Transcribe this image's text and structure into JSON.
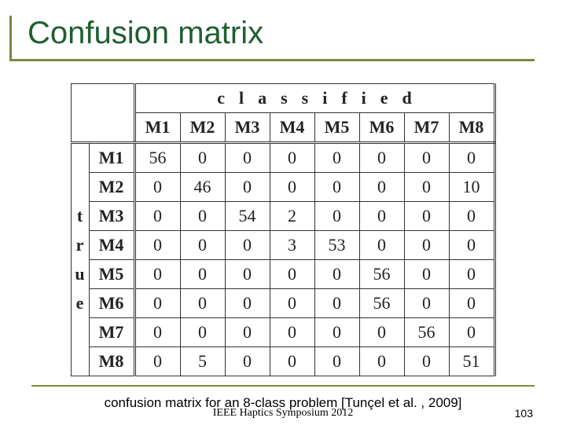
{
  "title": "Confusion matrix",
  "top_axis_label": "classified",
  "left_axis_label": [
    "t",
    "r",
    "u",
    "e"
  ],
  "col_headers": [
    "M1",
    "M2",
    "M3",
    "M4",
    "M5",
    "M6",
    "M7",
    "M8"
  ],
  "row_headers": [
    "M1",
    "M2",
    "M3",
    "M4",
    "M5",
    "M6",
    "M7",
    "M8"
  ],
  "matrix": [
    [
      56,
      0,
      0,
      0,
      0,
      0,
      0,
      0
    ],
    [
      0,
      46,
      0,
      0,
      0,
      0,
      0,
      10
    ],
    [
      0,
      0,
      54,
      2,
      0,
      0,
      0,
      0
    ],
    [
      0,
      0,
      0,
      3,
      53,
      0,
      0,
      0
    ],
    [
      0,
      0,
      0,
      0,
      0,
      56,
      0,
      0
    ],
    [
      0,
      0,
      0,
      0,
      0,
      56,
      0,
      0
    ],
    [
      0,
      0,
      0,
      0,
      0,
      0,
      56,
      0
    ],
    [
      0,
      5,
      0,
      0,
      0,
      0,
      0,
      51
    ]
  ],
  "caption": "confusion matrix for an 8-class problem [Tunçel et al. , 2009]",
  "venue": "IEEE Haptics Symposium 2012",
  "page_number": "103",
  "chart_data": {
    "type": "table",
    "title": "Confusion matrix",
    "row_axis": "true",
    "col_axis": "classified",
    "categories": [
      "M1",
      "M2",
      "M3",
      "M4",
      "M5",
      "M6",
      "M7",
      "M8"
    ],
    "values": [
      [
        56,
        0,
        0,
        0,
        0,
        0,
        0,
        0
      ],
      [
        0,
        46,
        0,
        0,
        0,
        0,
        0,
        10
      ],
      [
        0,
        0,
        54,
        2,
        0,
        0,
        0,
        0
      ],
      [
        0,
        0,
        0,
        3,
        53,
        0,
        0,
        0
      ],
      [
        0,
        0,
        0,
        0,
        0,
        56,
        0,
        0
      ],
      [
        0,
        0,
        0,
        0,
        0,
        56,
        0,
        0
      ],
      [
        0,
        0,
        0,
        0,
        0,
        0,
        56,
        0
      ],
      [
        0,
        5,
        0,
        0,
        0,
        0,
        0,
        51
      ]
    ]
  }
}
